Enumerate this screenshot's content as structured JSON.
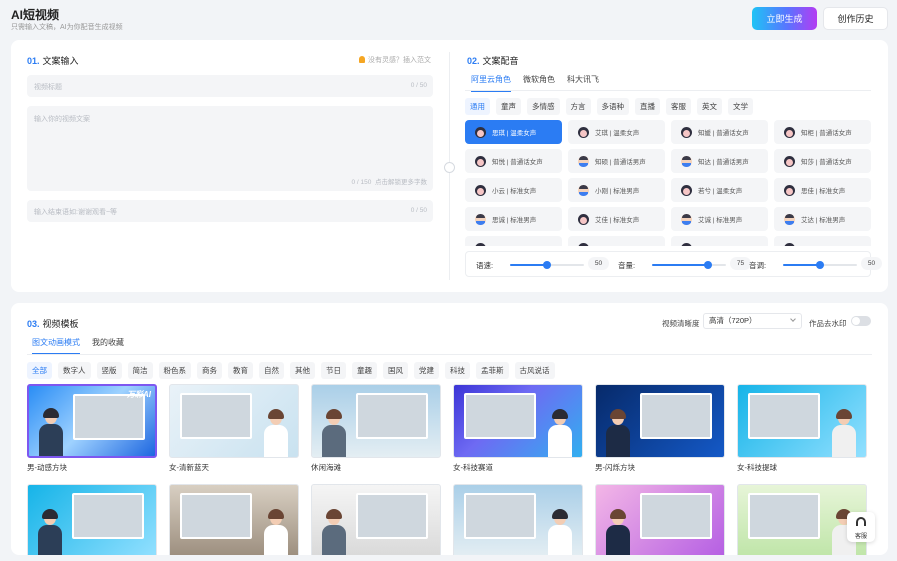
{
  "header": {
    "title": "AI短视频",
    "subtitle": "只需输入文稿，AI为你配音生成视频",
    "generate_label": "立即生成",
    "history_label": "创作历史"
  },
  "script_input": {
    "num": "01.",
    "title": "文案输入",
    "hint": "没有灵感？插入范文",
    "title_field": {
      "placeholder": "视频标题",
      "count": "0 / 50"
    },
    "content_field": {
      "placeholder": "输入你的视频文案",
      "count": "0 / 150",
      "extra": "点击解锁更多字数"
    },
    "ending_field": {
      "placeholder": "输入结束语如:谢谢观看~等",
      "count": "0 / 50"
    }
  },
  "voice": {
    "num": "02.",
    "title": "文案配音",
    "providers": [
      "阿里云角色",
      "微软角色",
      "科大讯飞"
    ],
    "categories": [
      "通用",
      "童声",
      "多情感",
      "方言",
      "多语种",
      "直播",
      "客服",
      "英文",
      "文学"
    ],
    "voices": [
      {
        "label": "思琪 | 温柔女声",
        "gender": "f",
        "selected": true
      },
      {
        "label": "艾琪 | 温柔女声",
        "gender": "f"
      },
      {
        "label": "知媛 | 普通话女声",
        "gender": "f"
      },
      {
        "label": "知柜 | 普通话女声",
        "gender": "f"
      },
      {
        "label": "知悦 | 普通话女声",
        "gender": "f"
      },
      {
        "label": "知硕 | 普通话男声",
        "gender": "m"
      },
      {
        "label": "知达 | 普通话男声",
        "gender": "m"
      },
      {
        "label": "知莎 | 普通话女声",
        "gender": "f"
      },
      {
        "label": "小云 | 标准女声",
        "gender": "f"
      },
      {
        "label": "小刚 | 标准男声",
        "gender": "m"
      },
      {
        "label": "若兮 | 温柔女声",
        "gender": "f"
      },
      {
        "label": "思佳 | 标准女声",
        "gender": "f"
      },
      {
        "label": "思诚 | 标准男声",
        "gender": "m"
      },
      {
        "label": "艾佳 | 标准女声",
        "gender": "f"
      },
      {
        "label": "艾诚 | 标准男声",
        "gender": "m"
      },
      {
        "label": "艾达 | 标准男声",
        "gender": "m"
      },
      {
        "label": "",
        "gender": "f"
      },
      {
        "label": "",
        "gender": "f"
      },
      {
        "label": "",
        "gender": "f"
      },
      {
        "label": "",
        "gender": "f"
      }
    ],
    "sliders": [
      {
        "label": "语速:",
        "value": "50",
        "fraction": 0.5
      },
      {
        "label": "音量:",
        "value": "75",
        "fraction": 0.75
      },
      {
        "label": "音调:",
        "value": "50",
        "fraction": 0.5
      }
    ]
  },
  "templates": {
    "num": "03.",
    "title": "视频模板",
    "quality_label": "视频清晰度",
    "quality_value": "高清（720P）",
    "watermark_label": "作品去水印",
    "watermark_on": false,
    "tabs": [
      "图文动画模式",
      "我的收藏"
    ],
    "filters": [
      "全部",
      "数字人",
      "竖版",
      "简洁",
      "粉色系",
      "商务",
      "教育",
      "自然",
      "其他",
      "节日",
      "童趣",
      "国风",
      "党建",
      "科技",
      "孟菲斯",
      "古风说话"
    ],
    "items": [
      {
        "caption": "男-动感方块",
        "style": "bg-blue",
        "badge": "万彩AI",
        "selected": true
      },
      {
        "caption": "女-清新蓝天",
        "style": "bg-light"
      },
      {
        "caption": "休闲海滩",
        "style": "bg-sky"
      },
      {
        "caption": "女-科技赛道",
        "style": "bg-tech"
      },
      {
        "caption": "男-闪烁方块",
        "style": "bg-navy"
      },
      {
        "caption": "女-科技提球",
        "style": "bg-cyan"
      },
      {
        "caption": "",
        "style": "bg-cyan"
      },
      {
        "caption": "",
        "style": "bg-room"
      },
      {
        "caption": "",
        "style": "bg-ink"
      },
      {
        "caption": "",
        "style": "bg-sky"
      },
      {
        "caption": "",
        "style": "bg-pink"
      },
      {
        "caption": "",
        "style": "bg-green"
      }
    ]
  },
  "support": {
    "label": "客服"
  }
}
